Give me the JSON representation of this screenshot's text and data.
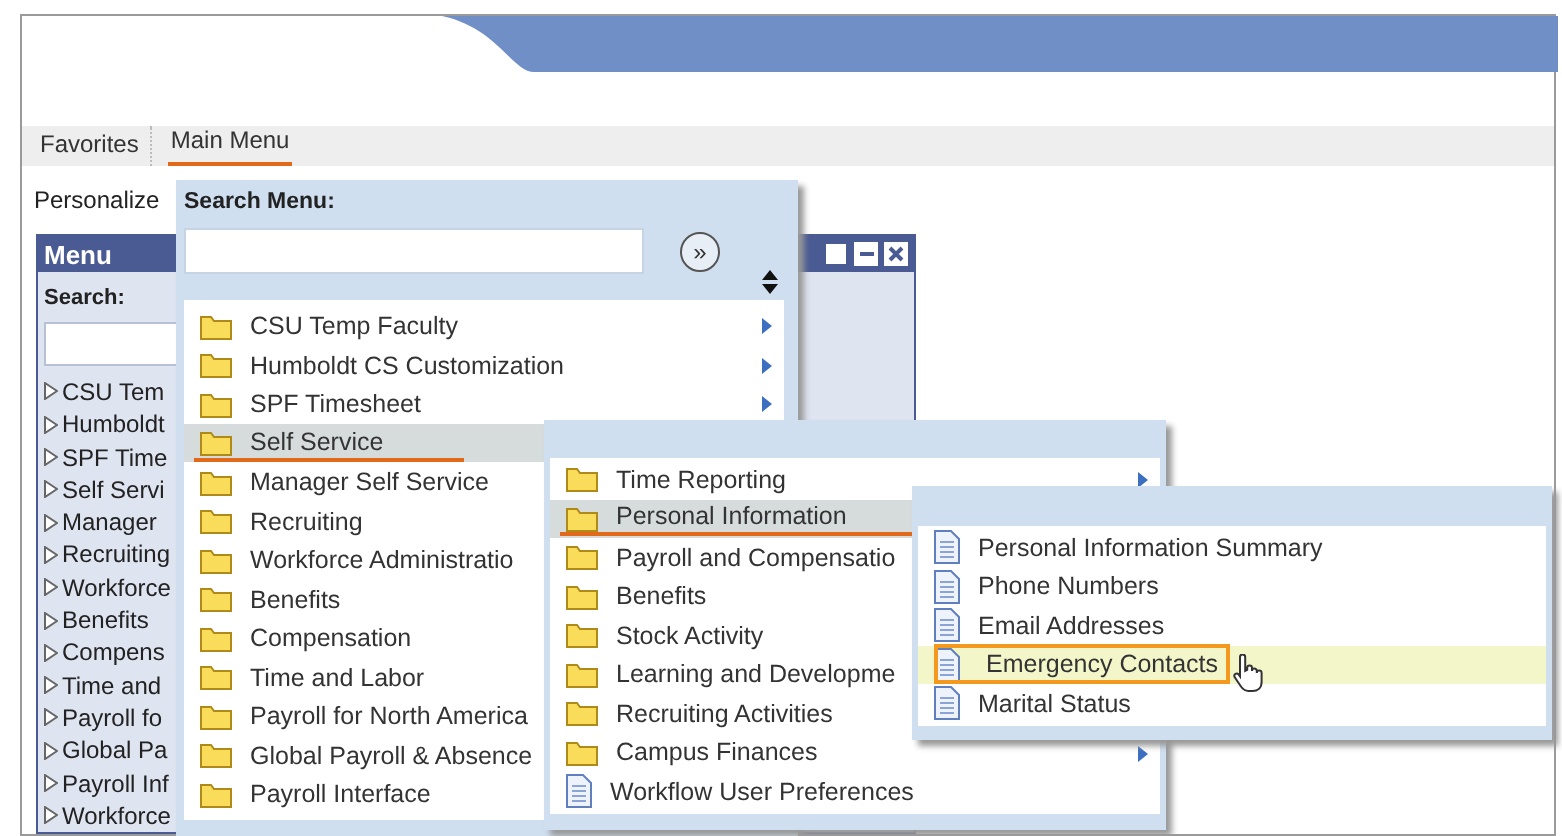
{
  "nav": [
    {
      "label": "Favorites",
      "selected": false
    },
    {
      "label": "Main Menu",
      "selected": true
    }
  ],
  "personalize": "Personalize",
  "menu_portlet": {
    "title": "Menu",
    "search_label": "Search:",
    "items": [
      "CSU Tem",
      "Humboldt",
      "SPF Time",
      "Self Servi",
      "Manager",
      "Recruiting",
      "Workforce",
      "Benefits",
      "Compens",
      "Time and",
      "Payroll fo",
      "Global Pa",
      "Payroll Inf",
      "Workforce"
    ]
  },
  "menus": [
    {
      "search_label": "Search Menu:",
      "go_button": "»",
      "items": [
        {
          "label": "CSU Temp Faculty",
          "kind": "folder",
          "has_submenu": true,
          "selected": false
        },
        {
          "label": "Humboldt CS Customization",
          "kind": "folder",
          "has_submenu": true,
          "selected": false
        },
        {
          "label": "SPF Timesheet",
          "kind": "folder",
          "has_submenu": true,
          "selected": false
        },
        {
          "label": "Self Service",
          "kind": "folder",
          "has_submenu": false,
          "selected": true
        },
        {
          "label": "Manager Self Service",
          "kind": "folder",
          "has_submenu": false,
          "selected": false
        },
        {
          "label": "Recruiting",
          "kind": "folder",
          "has_submenu": false,
          "selected": false
        },
        {
          "label": "Workforce Administratio",
          "kind": "folder",
          "has_submenu": false,
          "selected": false
        },
        {
          "label": "Benefits",
          "kind": "folder",
          "has_submenu": false,
          "selected": false
        },
        {
          "label": "Compensation",
          "kind": "folder",
          "has_submenu": false,
          "selected": false
        },
        {
          "label": "Time and Labor",
          "kind": "folder",
          "has_submenu": false,
          "selected": false
        },
        {
          "label": "Payroll for North America",
          "kind": "folder",
          "has_submenu": false,
          "selected": false
        },
        {
          "label": "Global Payroll & Absence",
          "kind": "folder",
          "has_submenu": false,
          "selected": false
        },
        {
          "label": "Payroll Interface",
          "kind": "folder",
          "has_submenu": false,
          "selected": false
        }
      ]
    },
    {
      "items": [
        {
          "label": "Time Reporting",
          "kind": "folder",
          "has_submenu": true,
          "selected": false
        },
        {
          "label": "Personal Information",
          "kind": "folder",
          "has_submenu": false,
          "selected": true
        },
        {
          "label": "Payroll and Compensatio",
          "kind": "folder",
          "has_submenu": false,
          "selected": false
        },
        {
          "label": "Benefits",
          "kind": "folder",
          "has_submenu": false,
          "selected": false
        },
        {
          "label": "Stock Activity",
          "kind": "folder",
          "has_submenu": false,
          "selected": false
        },
        {
          "label": "Learning and Developme",
          "kind": "folder",
          "has_submenu": false,
          "selected": false
        },
        {
          "label": "Recruiting Activities",
          "kind": "folder",
          "has_submenu": false,
          "selected": false
        },
        {
          "label": "Campus Finances",
          "kind": "folder",
          "has_submenu": true,
          "selected": false
        },
        {
          "label": "Workflow User Preferences",
          "kind": "page",
          "has_submenu": false,
          "selected": false
        }
      ]
    },
    {
      "items": [
        {
          "label": "Personal Information Summary",
          "kind": "page",
          "has_submenu": false,
          "selected": false
        },
        {
          "label": "Phone Numbers",
          "kind": "page",
          "has_submenu": false,
          "selected": false
        },
        {
          "label": "Email Addresses",
          "kind": "page",
          "has_submenu": false,
          "selected": false
        },
        {
          "label": "Emergency Contacts",
          "kind": "page",
          "has_submenu": false,
          "selected": true
        },
        {
          "label": "Marital Status",
          "kind": "page",
          "has_submenu": false,
          "selected": false
        }
      ]
    }
  ]
}
